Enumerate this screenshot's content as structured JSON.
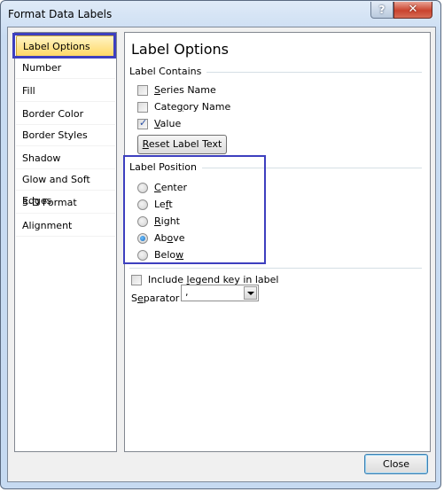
{
  "window": {
    "title": "Format Data Labels",
    "help_label": "?",
    "close_glyph": "✕"
  },
  "sidebar": {
    "items": [
      {
        "label": "Label Options",
        "selected": true
      },
      {
        "label": "Number"
      },
      {
        "label": "Fill"
      },
      {
        "label": "Border Color"
      },
      {
        "label": "Border Styles"
      },
      {
        "label": "Shadow"
      },
      {
        "label": "Glow and Soft Edges"
      },
      {
        "label": "3-D Format"
      },
      {
        "label": "Alignment"
      }
    ]
  },
  "main": {
    "heading": "Label Options",
    "label_contains": {
      "title": "Label Contains",
      "series_name": {
        "pre": "",
        "ul": "S",
        "post": "eries Name",
        "checked": false
      },
      "category_name": {
        "pre": "Cate",
        "ul": "g",
        "post": "ory Name",
        "checked": false
      },
      "value": {
        "pre": "",
        "ul": "V",
        "post": "alue",
        "checked": true
      },
      "reset_button": {
        "pre": "",
        "ul": "R",
        "post": "eset Label Text"
      }
    },
    "label_position": {
      "title": "Label Position",
      "options": [
        {
          "pre": "",
          "ul": "C",
          "post": "enter",
          "checked": false
        },
        {
          "pre": "Le",
          "ul": "f",
          "post": "t",
          "checked": false
        },
        {
          "pre": "",
          "ul": "R",
          "post": "ight",
          "checked": false
        },
        {
          "pre": "Ab",
          "ul": "o",
          "post": "ve",
          "checked": true
        },
        {
          "pre": "Belo",
          "ul": "w",
          "post": "",
          "checked": false
        }
      ]
    },
    "legend_key": {
      "pre": "Include ",
      "ul": "l",
      "post": "egend key in label",
      "checked": false
    },
    "separator": {
      "pre": "S",
      "ul": "e",
      "post": "parator",
      "value": ","
    }
  },
  "footer": {
    "close_label": "Close"
  },
  "colors": {
    "highlight_border": "#3d3fbf",
    "selected_item": "#ffd866"
  }
}
